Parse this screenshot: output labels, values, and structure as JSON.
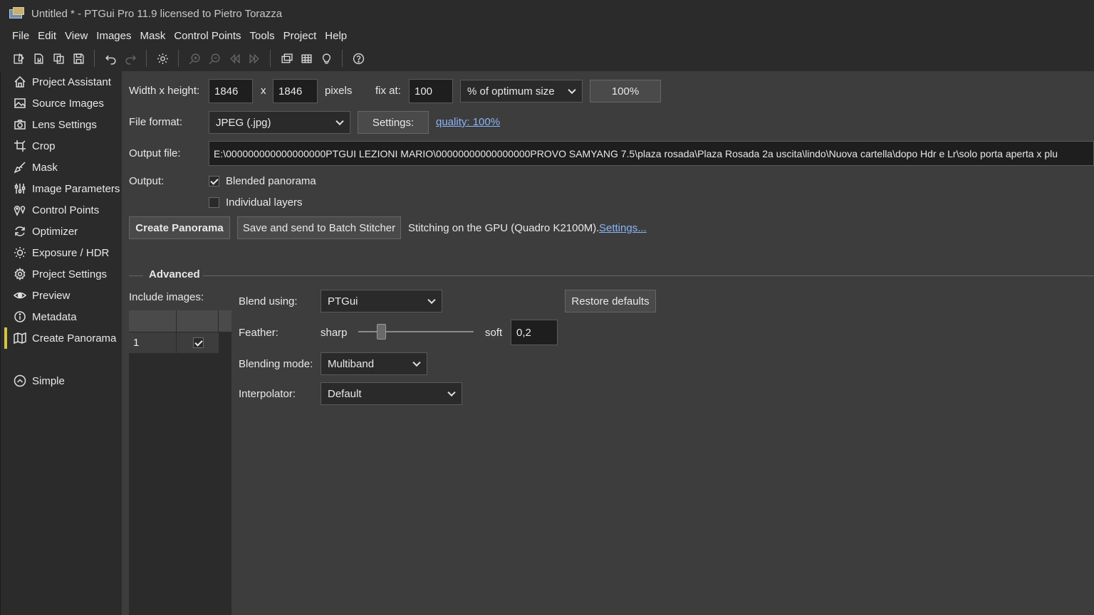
{
  "window": {
    "title": "Untitled * - PTGui Pro 11.9 licensed to Pietro Torazza"
  },
  "menu": [
    "File",
    "Edit",
    "View",
    "Images",
    "Mask",
    "Control Points",
    "Tools",
    "Project",
    "Help"
  ],
  "sidebar": {
    "items": [
      {
        "label": "Project Assistant",
        "icon": "home-icon"
      },
      {
        "label": "Source Images",
        "icon": "image-icon"
      },
      {
        "label": "Lens Settings",
        "icon": "camera-icon"
      },
      {
        "label": "Crop",
        "icon": "crop-icon"
      },
      {
        "label": "Mask",
        "icon": "brush-icon"
      },
      {
        "label": "Image Parameters",
        "icon": "sliders-icon"
      },
      {
        "label": "Control Points",
        "icon": "control-points-icon"
      },
      {
        "label": "Optimizer",
        "icon": "optimizer-icon"
      },
      {
        "label": "Exposure / HDR",
        "icon": "sun-icon"
      },
      {
        "label": "Project Settings",
        "icon": "gear-icon"
      },
      {
        "label": "Preview",
        "icon": "eye-icon"
      },
      {
        "label": "Metadata",
        "icon": "info-icon"
      },
      {
        "label": "Create Panorama",
        "icon": "panorama-icon",
        "active": true
      }
    ],
    "simple_label": "Simple"
  },
  "output_size": {
    "label": "Width x height:",
    "width": "1846",
    "x_label": "x",
    "height": "1846",
    "pixels_label": "pixels",
    "fix_at_label": "fix at:",
    "fix_value": "100",
    "fix_mode": "% of optimum size",
    "percent_button": "100%"
  },
  "file_format": {
    "label": "File format:",
    "value": "JPEG (.jpg)",
    "settings_button": "Settings:",
    "quality_link": "quality: 100%"
  },
  "output_file": {
    "label": "Output file:",
    "value": "E:\\000000000000000000PTGUI  LEZIONI MARIO\\00000000000000000PROVO  SAMYANG 7.5\\plaza rosada\\Plaza Rosada 2a uscita\\lindo\\Nuova cartella\\dopo Hdr e Lr\\solo porta aperta x plu"
  },
  "output": {
    "label": "Output:",
    "blended": {
      "label": "Blended panorama",
      "checked": true
    },
    "layers": {
      "label": "Individual layers",
      "checked": false
    }
  },
  "actions": {
    "create_button": "Create Panorama",
    "batch_button": "Save and send to Batch Stitcher",
    "gpu_text": "Stitching on the GPU (Quadro K2100M).",
    "gpu_settings_link": "Settings..."
  },
  "advanced": {
    "title": "Advanced",
    "include_images_label": "Include images:",
    "image_rows": [
      {
        "index": "1",
        "included": true
      }
    ],
    "blend_using_label": "Blend using:",
    "blend_using_value": "PTGui",
    "restore_defaults_button": "Restore defaults",
    "feather_label": "Feather:",
    "sharp_label": "sharp",
    "soft_label": "soft",
    "feather_value": "0,2",
    "feather_level": 0.2,
    "blending_mode_label": "Blending mode:",
    "blending_mode_value": "Multiband",
    "interpolator_label": "Interpolator:",
    "interpolator_value": "Default"
  }
}
